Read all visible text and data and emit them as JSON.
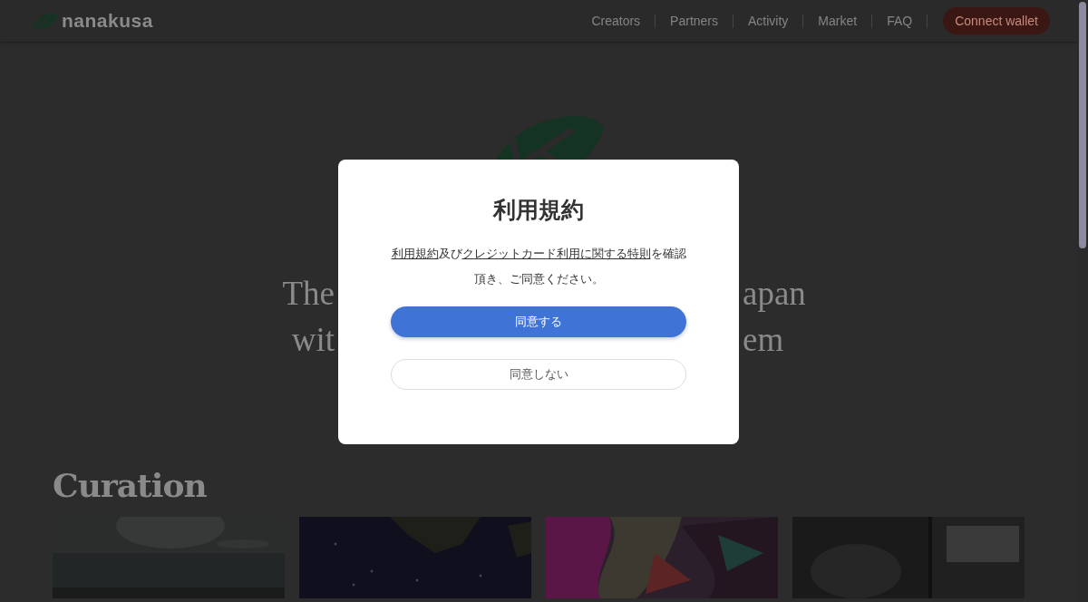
{
  "header": {
    "logo": "nanakusa",
    "nav": [
      "Creators",
      "Partners",
      "Activity",
      "Market",
      "FAQ"
    ],
    "connect_button": "Connect wallet"
  },
  "hero": {
    "line_fragments": [
      {
        "left": "The",
        "right": "apan"
      },
      {
        "left": "wit",
        "right": "em"
      }
    ]
  },
  "section": {
    "title": "Curation"
  },
  "modal": {
    "title": "利用規約",
    "notice": {
      "lines": [
        [
          {
            "text": "利用規約",
            "kind": "link"
          },
          {
            "text": "及び",
            "kind": "text"
          },
          {
            "text": "クレジットカード利用に関する特則",
            "kind": "link"
          },
          {
            "text": "を確認",
            "kind": "text"
          }
        ],
        [
          {
            "text": "頂き、ご同意ください。",
            "kind": "text"
          }
        ]
      ]
    },
    "buttons": [
      {
        "label": "同意する",
        "kind": "primary"
      },
      {
        "label": "同意しない",
        "kind": "secondary"
      }
    ]
  }
}
